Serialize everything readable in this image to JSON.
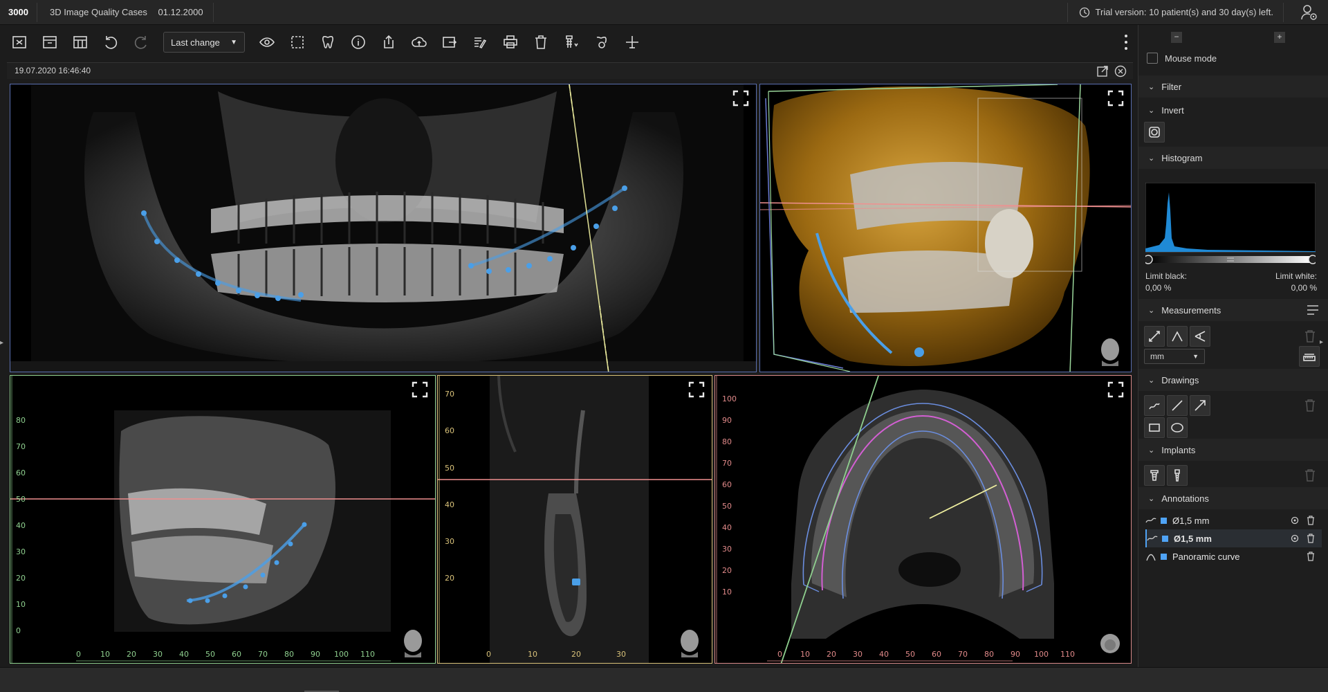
{
  "titlebar": {
    "tab_id": "3000",
    "case_title": "3D Image Quality Cases",
    "case_date": "01.12.2000",
    "trial_text": "Trial version: 10 patient(s) and 30 day(s) left."
  },
  "toolbar": {
    "history_dropdown": "Last change",
    "icons": [
      "layout-1-icon",
      "layout-2-icon",
      "layout-3-icon",
      "undo-icon",
      "redo-icon",
      "view-icon",
      "select-region-icon",
      "tooth-icon",
      "info-icon",
      "export-icon",
      "upload-icon",
      "share-icon",
      "report-icon",
      "print-icon",
      "delete-icon",
      "implant-list-icon",
      "tooth-settings-icon",
      "crosshair-icon"
    ]
  },
  "viewer": {
    "timestamp": "19.07.2020 16:46:40"
  },
  "views": {
    "sagittal": {
      "y_ticks": [
        "80",
        "70",
        "60",
        "50",
        "40",
        "30",
        "20",
        "10",
        "0"
      ],
      "x_ticks": [
        "0",
        "10",
        "20",
        "30",
        "40",
        "50",
        "60",
        "70",
        "80",
        "90",
        "100",
        "110"
      ]
    },
    "cross": {
      "y_ticks": [
        "70",
        "60",
        "50",
        "40",
        "30",
        "20"
      ],
      "x_ticks": [
        "0",
        "10",
        "20",
        "30"
      ]
    },
    "axial": {
      "y_ticks": [
        "100",
        "90",
        "80",
        "70",
        "60",
        "50",
        "40",
        "30",
        "20",
        "10"
      ],
      "x_ticks": [
        "0",
        "10",
        "20",
        "30",
        "40",
        "50",
        "60",
        "70",
        "80",
        "90",
        "100",
        "110"
      ]
    }
  },
  "sidebar": {
    "mouse_mode": "Mouse mode",
    "filter": "Filter",
    "invert": "Invert",
    "histogram": "Histogram",
    "limit_black_label": "Limit black:",
    "limit_black_value": "0,00 %",
    "limit_white_label": "Limit white:",
    "limit_white_value": "0,00 %",
    "measurements": "Measurements",
    "unit": "mm",
    "drawings": "Drawings",
    "implants": "Implants",
    "annotations": "Annotations",
    "annotation_items": [
      "Ø1,5 mm",
      "Ø1,5 mm",
      "Panoramic curve"
    ]
  },
  "colors": {
    "accent": "#4fa3f5",
    "curve": "#4a9fe8",
    "red_line": "#f09090",
    "yellow_line": "#f0f0a0",
    "green_frame": "#8fd08f",
    "pink_frame": "#d98a8a"
  }
}
